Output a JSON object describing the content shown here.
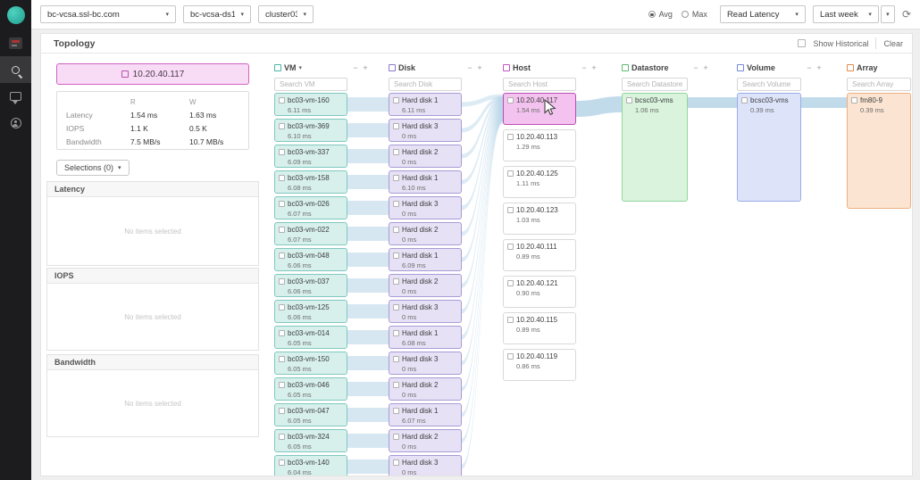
{
  "topbar": {
    "vcenter": "bc-vcsa.ssl-bc.com",
    "datacenter": "bc-vcsa-ds1",
    "cluster": "cluster03",
    "avg": "Avg",
    "max": "Max",
    "metric": "Read Latency",
    "range": "Last week"
  },
  "titlebar": {
    "title": "Topology",
    "show_historical": "Show Historical",
    "clear": "Clear"
  },
  "detail": {
    "host": "10.20.40.117",
    "col_r": "R",
    "col_w": "W",
    "rows": [
      {
        "label": "Latency",
        "r": "1.54 ms",
        "w": "1.63 ms"
      },
      {
        "label": "IOPS",
        "r": "1.1 K",
        "w": "0.5 K"
      },
      {
        "label": "Bandwidth",
        "r": "7.5 MB/s",
        "w": "10.7 MB/s"
      }
    ]
  },
  "selections": {
    "label": "Selections (0)",
    "sections": [
      {
        "title": "Latency",
        "empty": "No items selected"
      },
      {
        "title": "IOPS",
        "empty": "No items selected"
      },
      {
        "title": "Bandwidth",
        "empty": "No items selected"
      }
    ]
  },
  "topology": {
    "link_color": "#86b7d7",
    "columns": [
      {
        "id": "vm",
        "label": "VM",
        "has_dropdown": true,
        "search": "Search VM",
        "bg": "#d7f0ec",
        "border": "#7fc8bf",
        "accent": "#4db3a6",
        "items": [
          {
            "name": "bc03-vm-160",
            "value": "6.11 ms"
          },
          {
            "name": "bc03-vm-369",
            "value": "6.10 ms"
          },
          {
            "name": "bc03-vm-337",
            "value": "6.09 ms"
          },
          {
            "name": "bc03-vm-158",
            "value": "6.08 ms"
          },
          {
            "name": "bc03-vm-026",
            "value": "6.07 ms"
          },
          {
            "name": "bc03-vm-022",
            "value": "6.07 ms"
          },
          {
            "name": "bc03-vm-048",
            "value": "6.06 ms"
          },
          {
            "name": "bc03-vm-037",
            "value": "6.06 ms"
          },
          {
            "name": "bc03-vm-125",
            "value": "6.06 ms"
          },
          {
            "name": "bc03-vm-014",
            "value": "6.05 ms"
          },
          {
            "name": "bc03-vm-150",
            "value": "6.05 ms"
          },
          {
            "name": "bc03-vm-046",
            "value": "6.05 ms"
          },
          {
            "name": "bc03-vm-047",
            "value": "6.05 ms"
          },
          {
            "name": "bc03-vm-324",
            "value": "6.05 ms"
          },
          {
            "name": "bc03-vm-140",
            "value": "6.04 ms"
          }
        ]
      },
      {
        "id": "disk",
        "label": "Disk",
        "search": "Search Disk",
        "bg": "#e7e1f5",
        "border": "#a89bd6",
        "accent": "#8a79c9",
        "items": [
          {
            "name": "Hard disk 1",
            "value": "6.11 ms"
          },
          {
            "name": "Hard disk 3",
            "value": "0 ms"
          },
          {
            "name": "Hard disk 2",
            "value": "0 ms"
          },
          {
            "name": "Hard disk 1",
            "value": "6.10 ms"
          },
          {
            "name": "Hard disk 3",
            "value": "0 ms"
          },
          {
            "name": "Hard disk 2",
            "value": "0 ms"
          },
          {
            "name": "Hard disk 1",
            "value": "6.09 ms"
          },
          {
            "name": "Hard disk 2",
            "value": "0 ms"
          },
          {
            "name": "Hard disk 3",
            "value": "0 ms"
          },
          {
            "name": "Hard disk 1",
            "value": "6.08 ms"
          },
          {
            "name": "Hard disk 3",
            "value": "0 ms"
          },
          {
            "name": "Hard disk 2",
            "value": "0 ms"
          },
          {
            "name": "Hard disk 1",
            "value": "6.07 ms"
          },
          {
            "name": "Hard disk 2",
            "value": "0 ms"
          },
          {
            "name": "Hard disk 3",
            "value": "0 ms"
          }
        ]
      },
      {
        "id": "host",
        "label": "Host",
        "search": "Search Host",
        "bg": "#ffffff",
        "border": "#d9d9d9",
        "accent": "#c158b8",
        "hl_bg": "#f3c2ef",
        "hl_border": "#bb4fb3",
        "items": [
          {
            "name": "10.20.40.117",
            "value": "1.54 ms",
            "highlighted": true
          },
          {
            "name": "10.20.40.113",
            "value": "1.29 ms"
          },
          {
            "name": "10.20.40.125",
            "value": "1.11 ms"
          },
          {
            "name": "10.20.40.123",
            "value": "1.03 ms"
          },
          {
            "name": "10.20.40.111",
            "value": "0.89 ms"
          },
          {
            "name": "10.20.40.121",
            "value": "0.90 ms"
          },
          {
            "name": "10.20.40.115",
            "value": "0.89 ms"
          },
          {
            "name": "10.20.40.119",
            "value": "0.86 ms"
          }
        ]
      },
      {
        "id": "datastore",
        "label": "Datastore",
        "search": "Search Datastore",
        "bg": "#d9f3dc",
        "border": "#90d69c",
        "accent": "#5dbb72",
        "items": [
          {
            "name": "bcsc03-vms",
            "value": "1.06 ms"
          }
        ]
      },
      {
        "id": "volume",
        "label": "Volume",
        "search": "Search Volume",
        "bg": "#dde4fa",
        "border": "#9aace6",
        "accent": "#7289d6",
        "items": [
          {
            "name": "bcsc03-vms",
            "value": "0.39 ms"
          }
        ]
      },
      {
        "id": "array",
        "label": "Array",
        "search": "Search Array",
        "bg": "#fbe5d2",
        "border": "#edb083",
        "accent": "#e08b4a",
        "items": [
          {
            "name": "fm80-9",
            "value": "0.39 ms"
          }
        ]
      }
    ]
  }
}
